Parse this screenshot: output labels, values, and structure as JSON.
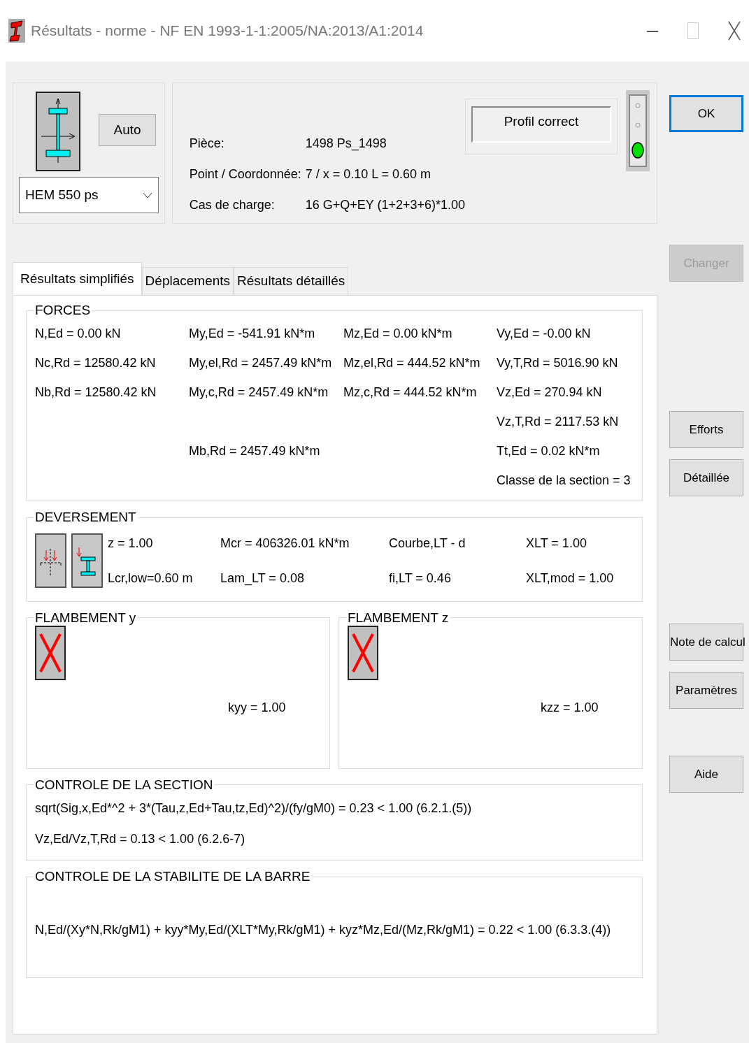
{
  "window": {
    "title": "Résultats - norme - NF EN 1993-1-1:2005/NA:2013/A1:2014"
  },
  "profile": {
    "auto_button": "Auto",
    "section": "HEM 550 ps"
  },
  "info": {
    "rows": [
      {
        "label": "Pièce:",
        "value": "1498  Ps_1498"
      },
      {
        "label": "Point / Coordonnée:",
        "value": "7 / x = 0.10 L = 0.60 m"
      },
      {
        "label": "Cas de charge:",
        "value": "16 G+Q+EY  (1+2+3+6)*1.00"
      }
    ],
    "status": "Profil correct",
    "lights": [
      {
        "on": false
      },
      {
        "on": false
      },
      {
        "on": true
      }
    ]
  },
  "buttons": [
    {
      "label": "OK",
      "default": true,
      "disabled": false
    },
    {
      "label": "Changer",
      "default": false,
      "disabled": true
    },
    {
      "label": "Efforts",
      "default": false,
      "disabled": false
    },
    {
      "label": "Détaillée",
      "default": false,
      "disabled": false
    },
    {
      "label": "Note de calcul",
      "default": false,
      "disabled": false
    },
    {
      "label": "Paramètres",
      "default": false,
      "disabled": false
    },
    {
      "label": "Aide",
      "default": false,
      "disabled": false
    }
  ],
  "tabs": [
    {
      "label": "Résultats simplifiés",
      "selected": true
    },
    {
      "label": "Déplacements",
      "selected": false
    },
    {
      "label": "Résultats détaillés",
      "selected": false
    }
  ],
  "forces": {
    "title": "FORCES",
    "rows": [
      {
        "column_1": "N,Ed = 0.00 kN",
        "column_2": "My,Ed = -541.91 kN*m",
        "column_3": "Mz,Ed = 0.00 kN*m",
        "column_4": "Vy,Ed = -0.00 kN"
      },
      {
        "column_1": "Nc,Rd = 12580.42 kN",
        "column_2": "My,el,Rd = 2457.49 kN*m",
        "column_3": "Mz,el,Rd = 444.52 kN*m",
        "column_4": "Vy,T,Rd = 5016.90 kN"
      },
      {
        "column_1": "Nb,Rd = 12580.42 kN",
        "column_2": "My,c,Rd = 2457.49 kN*m",
        "column_3": "Mz,c,Rd = 444.52 kN*m",
        "column_4": "Vz,Ed = 270.94 kN"
      },
      {
        "column_4": "Vz,T,Rd = 2117.53 kN"
      },
      {
        "column_2": "Mb,Rd = 2457.49 kN*m",
        "column_4": "Tt,Ed = 0.02 kN*m"
      },
      {
        "column_4": "Classe de la section = 3"
      }
    ]
  },
  "deversement": {
    "title": "DEVERSEMENT",
    "rows": [
      {
        "column_1": "z = 1.00",
        "column_2": "Mcr = 406326.01 kN*m",
        "column_3": "Courbe,LT - d",
        "column_4": "XLT = 1.00"
      },
      {
        "column_1": "Lcr,low=0.60 m",
        "column_2": "Lam_LT = 0.08",
        "column_3": "fi,LT = 0.46",
        "column_4": "XLT,mod = 1.00"
      }
    ]
  },
  "flambement": [
    {
      "title": "FLAMBEMENT y",
      "coefficient": "kyy = 1.00"
    },
    {
      "title": "FLAMBEMENT z",
      "coefficient": "kzz = 1.00"
    }
  ],
  "controle_section": {
    "title": "CONTROLE DE LA SECTION",
    "lines": [
      "sqrt(Sig,x,Ed*^2 + 3*(Tau,z,Ed+Tau,tz,Ed)^2)/(fy/gM0) = 0.23 < 1.00   (6.2.1.(5))",
      "Vz,Ed/Vz,T,Rd = 0.13 < 1.00   (6.2.6-7)"
    ]
  },
  "controle_stabilite": {
    "title": "CONTROLE DE LA STABILITE DE LA BARRE",
    "lines": [
      "N,Ed/(Xy*N,Rk/gM1) + kyy*My,Ed/(XLT*My,Rk/gM1) + kyz*Mz,Ed/(Mz,Rk/gM1) = 0.22 < 1.00   (6.3.3.(4))"
    ]
  }
}
